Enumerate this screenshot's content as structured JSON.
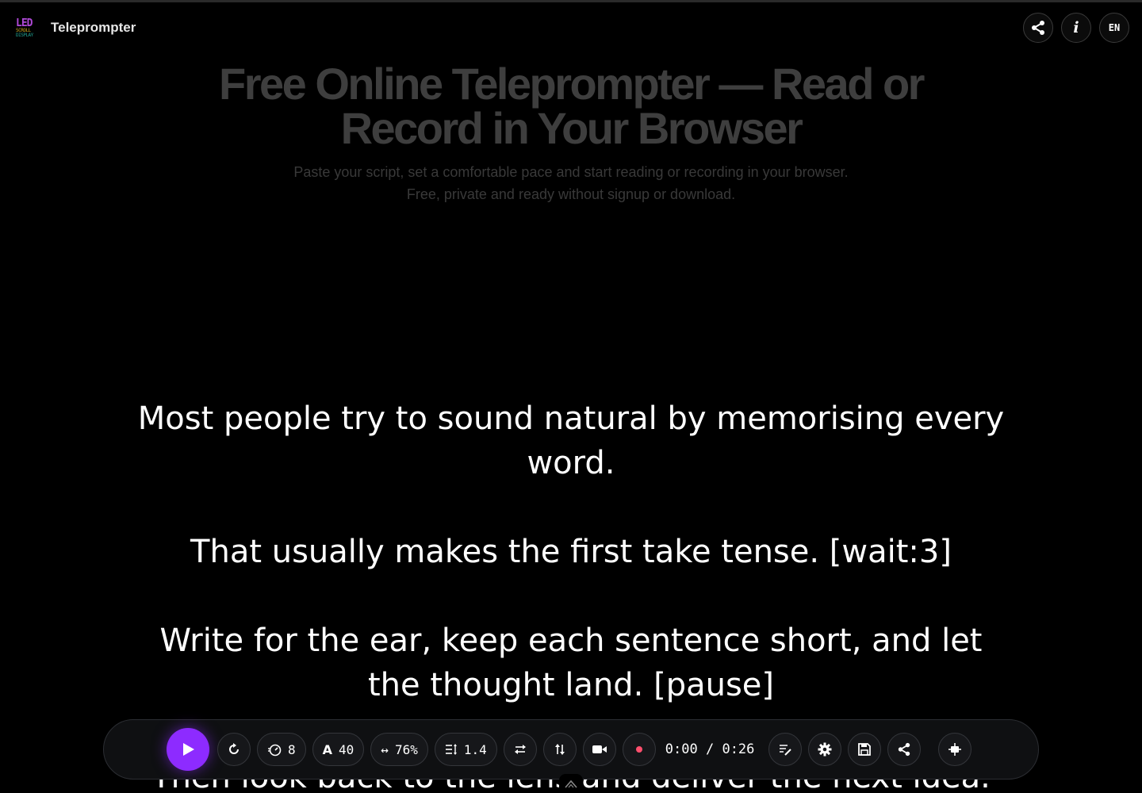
{
  "app": {
    "title": "Teleprompter",
    "logo_text": [
      "LED",
      "SCROLL",
      "DISPLAY"
    ]
  },
  "header_buttons": {
    "share_icon": "share-icon",
    "info_label": "i",
    "language": "EN"
  },
  "hero": {
    "title": "Free Online Teleprompter — Read or Record in Your Browser",
    "subtitle": "Paste your script, set a comfortable pace and start reading or recording in your browser. Free, private and ready without signup or download."
  },
  "script": {
    "paragraphs": [
      "Most people try to sound natural by memorising every word.",
      "That usually makes the first take tense. [wait:3]",
      "Write for the ear, keep each sentence short, and let the thought land. [pause]",
      "Then look back to the lens and deliver the next idea."
    ]
  },
  "controls": {
    "speed": "8",
    "font_size": "40",
    "width": "76%",
    "line_height": "1.4",
    "time_elapsed": "0:00",
    "time_separator": "/",
    "time_total": "0:26",
    "accent_color": "#8d2bff",
    "record_color": "#ff4f6d"
  }
}
